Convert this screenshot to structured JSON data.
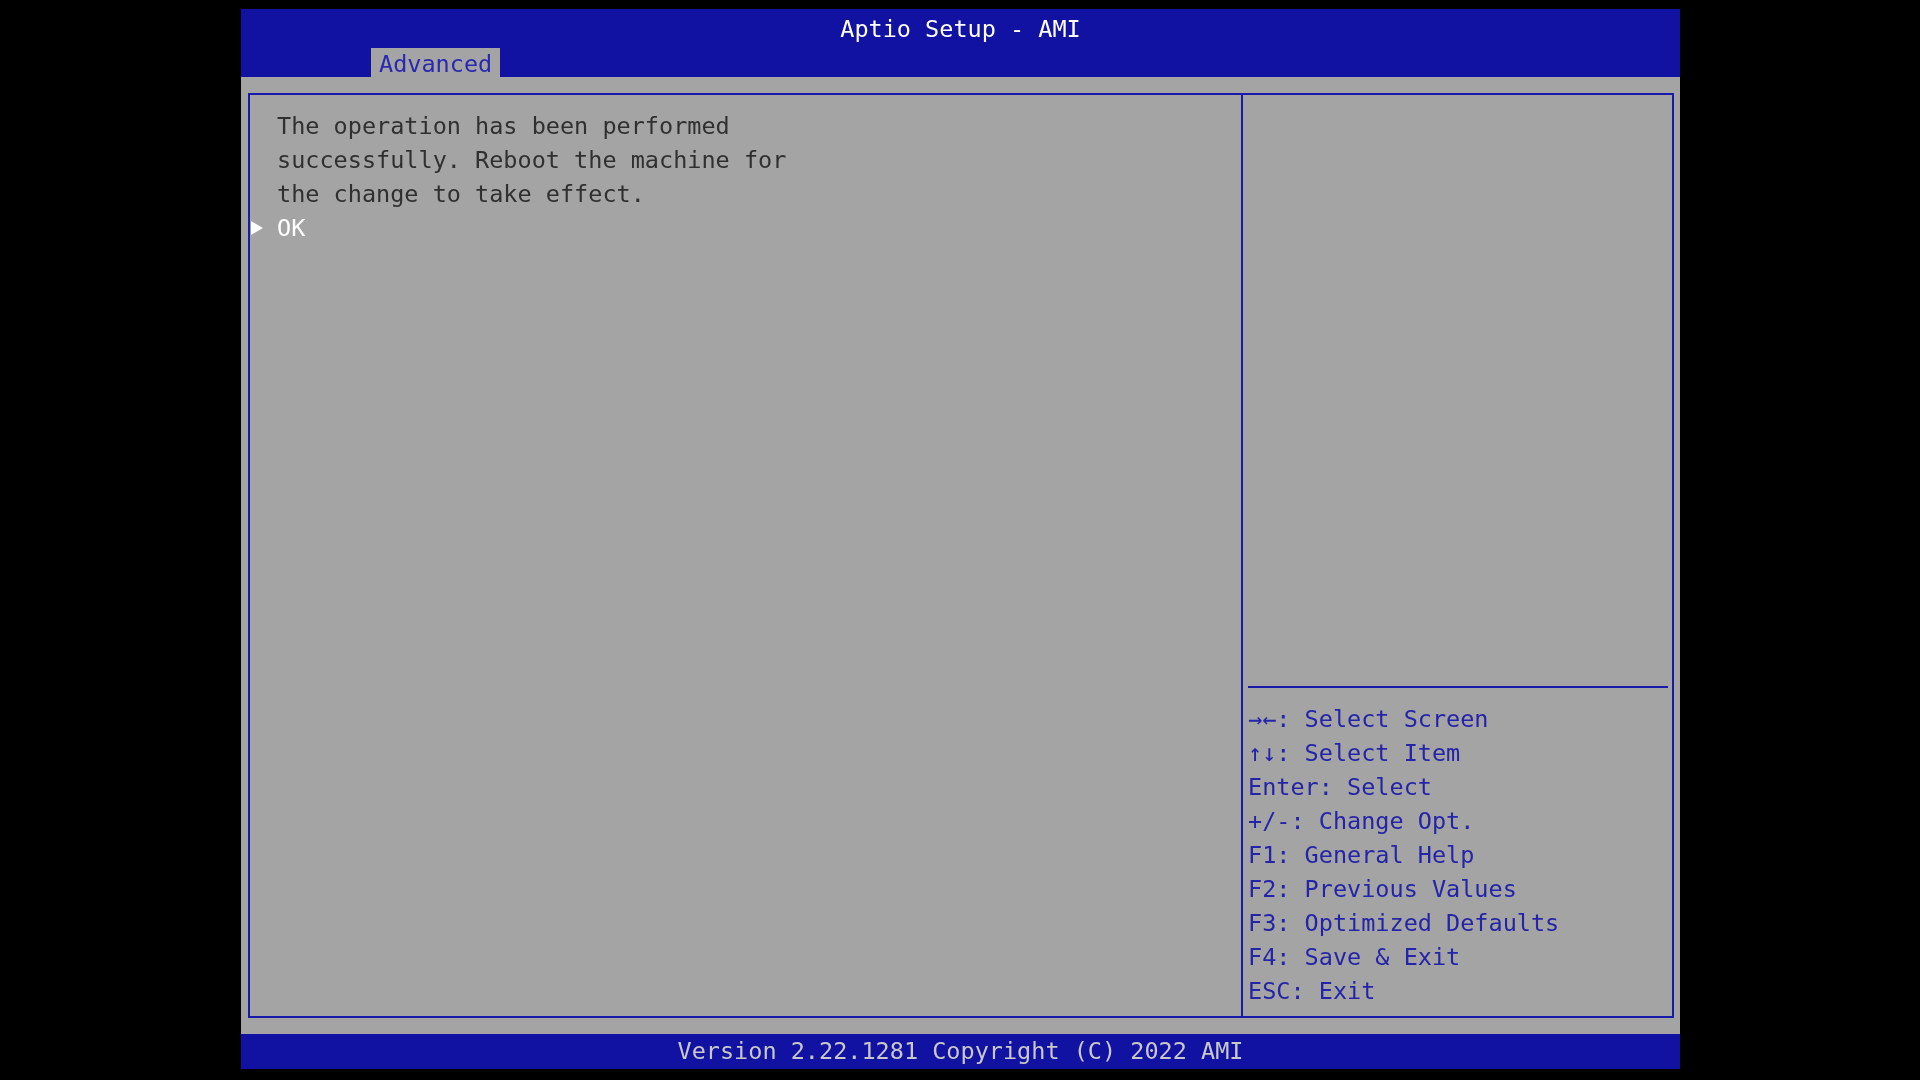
{
  "window": {
    "title": "Aptio Setup - AMI"
  },
  "tabs": [
    {
      "label": "Advanced",
      "selected": true
    }
  ],
  "message": "The operation has been performed successfully. Reboot the machine for the change to take effect.",
  "items": [
    {
      "label": "OK",
      "selected": true
    }
  ],
  "help": [
    "→←: Select Screen",
    "↑↓: Select Item",
    "Enter: Select",
    "+/-: Change Opt.",
    "F1: General Help",
    "F2: Previous Values",
    "F3: Optimized Defaults",
    "F4: Save & Exit",
    "ESC: Exit"
  ],
  "status_bar": "Version 2.22.1281 Copyright (C) 2022 AMI"
}
